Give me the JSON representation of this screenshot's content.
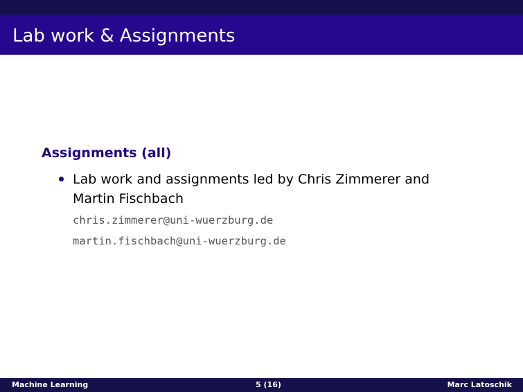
{
  "slide": {
    "title": "Lab work & Assignments",
    "block_title": "Assignments (all)",
    "bullets": [
      {
        "text": "Lab work and assignments led by Chris Zimmerer and Martin Fischbach",
        "emails": [
          "chris.zimmerer@uni-wuerzburg.de",
          "martin.fischbach@uni-wuerzburg.de"
        ]
      }
    ]
  },
  "footer": {
    "left": "Machine Learning",
    "center": "5 (16)",
    "right": "Marc Latoschik"
  },
  "colors": {
    "title_bar": "#26088f",
    "header_strip": "#15114a",
    "footer_bar": "#15114a",
    "block_title": "#24067d",
    "email_text": "#555555"
  }
}
